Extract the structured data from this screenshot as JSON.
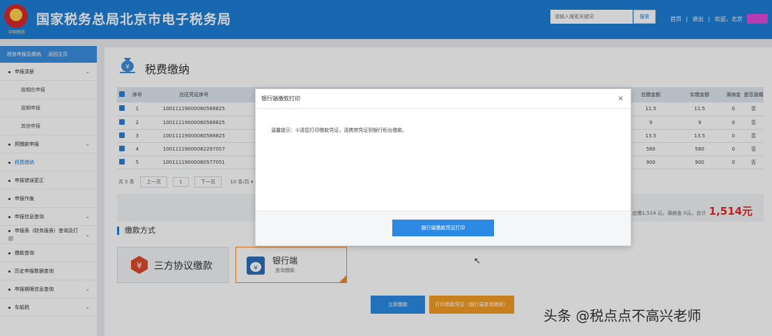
{
  "header": {
    "title": "国家税务总局北京市电子税务局",
    "emblem_text": "中国税务",
    "search_placeholder": "请输入搜索关键词",
    "search_button": "搜索",
    "links": [
      "首页",
      "退出",
      "欢迎，北京"
    ],
    "colors": {
      "bar": "#1d7fd8",
      "user_highlight": "#e04ad8"
    }
  },
  "sidebar": {
    "top_label": "税务申报及缴纳",
    "back_label": "返回主页",
    "items": [
      {
        "label": "申报清册",
        "chevron": "⌄"
      },
      {
        "label": "按期应申报"
      },
      {
        "label": "逾期申报"
      },
      {
        "label": "其他申报"
      },
      {
        "label": "预缴款申报",
        "chevron": "⌄"
      },
      {
        "label": "税费缴纳"
      },
      {
        "label": "申报错误更正"
      },
      {
        "label": "申报作废"
      },
      {
        "label": "申报信息查询",
        "chevron": "⌄"
      },
      {
        "label": "申报表（财务报表）查询及打印",
        "chevron": "⌄"
      },
      {
        "label": "缴款查询"
      },
      {
        "label": "历史申报数据查询"
      },
      {
        "label": "申报期限信息查询",
        "chevron": "⌄"
      },
      {
        "label": "车船税",
        "chevron": "⌄"
      }
    ]
  },
  "main": {
    "page_title": "税费缴纳",
    "table": {
      "headers": [
        "序号",
        "应征凭证序号",
        "应缴金额",
        "实缴金额",
        "滞纳金",
        "是否逾期"
      ],
      "rows": [
        {
          "no": "1",
          "voucher": "10011119000060588825",
          "due": "11.5",
          "paid": "11.5",
          "late": "0",
          "overdue": "否"
        },
        {
          "no": "2",
          "voucher": "10011119000060588825",
          "due": "9",
          "paid": "9",
          "late": "0",
          "overdue": "否"
        },
        {
          "no": "3",
          "voucher": "10011119000060588825",
          "due": "13.5",
          "paid": "13.5",
          "late": "0",
          "overdue": "否"
        },
        {
          "no": "4",
          "voucher": "10011119000062297057",
          "due": "560",
          "paid": "560",
          "late": "0",
          "overdue": "否"
        },
        {
          "no": "5",
          "voucher": "10011119000060577051",
          "due": "900",
          "paid": "900",
          "late": "0",
          "overdue": "否"
        }
      ]
    },
    "pager": {
      "total": "共 5 条",
      "prev": "上一页",
      "page": "1",
      "next": "下一页",
      "per_page": "10 条/页 ▾"
    },
    "total_bar": {
      "prefix": "应缴1,514 元，滞纳金 0元，合计",
      "amount": "1,514元"
    },
    "section_title": "缴款方式",
    "pay_methods": [
      {
        "label": "三方协议缴款"
      },
      {
        "label": "银行端",
        "sub": "查询缴款"
      }
    ],
    "buttons": {
      "pay_now": "立即缴款",
      "print_voucher": "打印缴款凭证（银行端查询缴税）"
    }
  },
  "modal": {
    "title": "银行端缴款打印",
    "close": "×",
    "message": "温馨提示：①请您打印缴款凭证，请携带凭证到银行柜台缴款。",
    "button": "银行端缴款凭证打印"
  },
  "watermark": "头条 @税点点不高兴老师"
}
